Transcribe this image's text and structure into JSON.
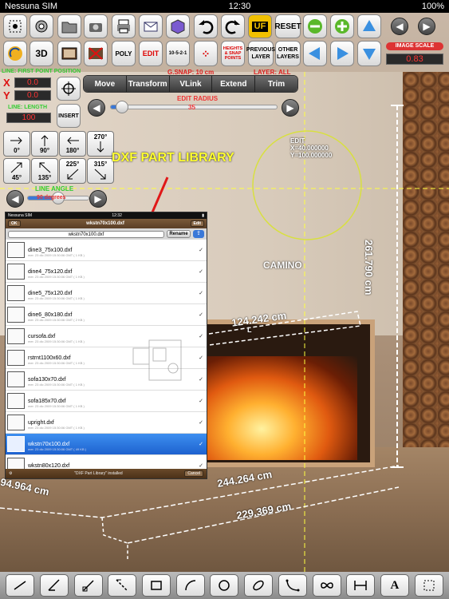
{
  "status": {
    "carrier": "Nessuna SIM",
    "time": "12:30",
    "battery": "100%"
  },
  "toolbar_row1": {
    "uf": "UF",
    "reset": "RESET"
  },
  "toolbar_row2": {
    "poly": "POLY",
    "edit": "EDIT",
    "scale_code": "10-5-2-1",
    "heights": "HEIGHTS & SNAP POINTS",
    "previous_layer": "PREVIOUS LAYER",
    "other_layers": "OTHER LAYERS",
    "image_scale_label": "IMAGE SCALE",
    "image_scale_value": "0.83"
  },
  "info": {
    "gsnap": "G.SNAP: 10 cm",
    "layer": "LAYER: ALL",
    "line_first_point": "LINE: FIRST POINT POSITION",
    "x_label": "X",
    "x_value": "0.0",
    "y_label": "Y",
    "y_value": "0.0",
    "line_length_label": "LINE: LENGTH",
    "line_length_value": "100",
    "insert": "INSERT",
    "edit_radius_label": "EDIT RADIUS",
    "edit_radius_value": "35",
    "line_angle_label": "LINE ANGLE",
    "line_angle_value": "90 degrees"
  },
  "segments": [
    "Move",
    "Transform",
    "VLink",
    "Extend",
    "Trim"
  ],
  "angles": [
    "0°",
    "90°",
    "180°",
    "270°",
    "45°",
    "135°",
    "225°",
    "315°"
  ],
  "canvas": {
    "annotation": "DXF PART LIBRARY",
    "edit_title": "EDIT",
    "edit_x": "X=40.000000",
    "edit_y": "Y=100.000000",
    "camino": "CAMINO",
    "dim_height": "261.790 cm",
    "dim_top": "124.242 cm",
    "dim_front": "244.264 cm",
    "dim_left": "94.964 cm",
    "dim_bottom": "229.369 cm",
    "dim_small": "L"
  },
  "library": {
    "status_left": "Nessuna SIM",
    "status_time": "12:32",
    "back": "OK",
    "title": "wkstn70x100.dxf",
    "edit": "Edit",
    "filename": "wkstn70x100.dxf",
    "rename": "Rename",
    "files": [
      {
        "name": "dine3_75x100.dxf",
        "meta": "mer. 23 dic 2009 15:30:06 GMT ( 1 KB )"
      },
      {
        "name": "dine4_75x120.dxf",
        "meta": "mer. 23 dic 2009 15:30:06 GMT ( 1 KB )"
      },
      {
        "name": "dine5_75x120.dxf",
        "meta": "mer. 23 dic 2009 15:30:06 GMT ( 1 KB )"
      },
      {
        "name": "dine6_80x180.dxf",
        "meta": "mer. 23 dic 2009 15:30:06 GMT ( 2 KB )"
      },
      {
        "name": "cursofa.dxf",
        "meta": "mer. 23 dic 2009 15:30:06 GMT ( 1 KB )"
      },
      {
        "name": "rstrnt1100x60.dxf",
        "meta": "mer. 23 dic 2009 15:30:06 GMT ( 1 KB )"
      },
      {
        "name": "sofa130x70.dxf",
        "meta": "mer. 23 dic 2009 15:30:06 GMT ( 1 KB )"
      },
      {
        "name": "sofa185x70.dxf",
        "meta": "mer. 23 dic 2009 15:30:06 GMT ( 1 KB )"
      },
      {
        "name": "upright.dxf",
        "meta": "mer. 23 dic 2009 15:30:06 GMT ( 1 KB )"
      },
      {
        "name": "wkstn70x100.dxf",
        "meta": "mer. 23 dic 2009 15:30:06 GMT ( 49 KB )"
      },
      {
        "name": "wkstn80x120.dxf",
        "meta": "mer. 23 dic 2009 15:30:06 GMT ( 2 KB )"
      }
    ],
    "footer": "\"DXF Part Library\" installed",
    "cancel": "Cancel"
  }
}
